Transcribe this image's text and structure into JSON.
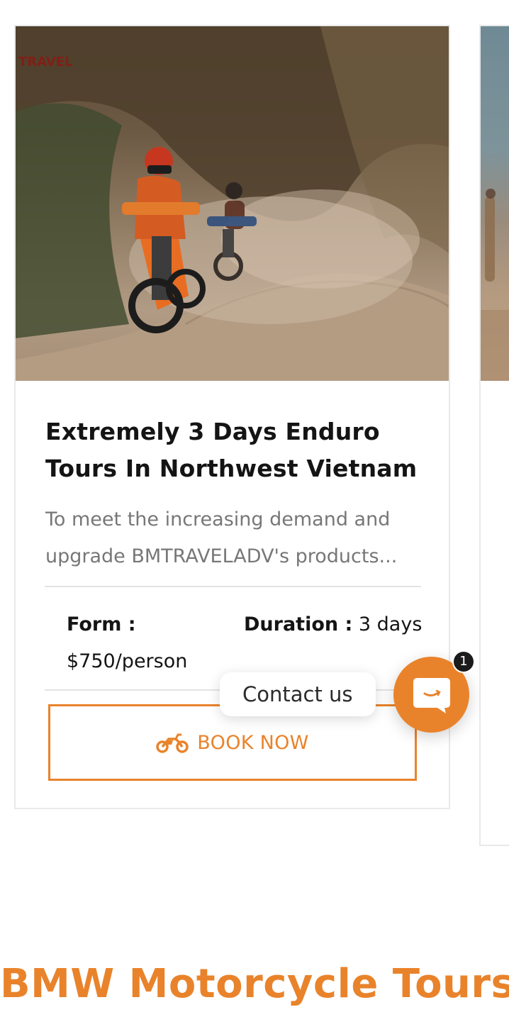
{
  "tour_card": {
    "image_watermark": "TRAVEL",
    "title": "Extremely 3 Days Enduro Tours In Northwest Vietnam",
    "excerpt": "To meet the increasing demand and upgrade BMTRAVELADV's products...",
    "price_label": "Form :",
    "price_value": "$750/person",
    "duration_label": "Duration :",
    "duration_value": "3 days",
    "book_button": {
      "label": "BOOK NOW",
      "icon": "motorcycle-icon"
    }
  },
  "chat_widget": {
    "label": "Contact us",
    "badge_count": "1",
    "icon": "chat-smile-icon"
  },
  "section": {
    "heading": "BMW Motorcycle Tours"
  },
  "colors": {
    "accent": "#e9832b",
    "title_text": "#141414",
    "body_text": "#777777",
    "border": "#e9e9e9"
  }
}
